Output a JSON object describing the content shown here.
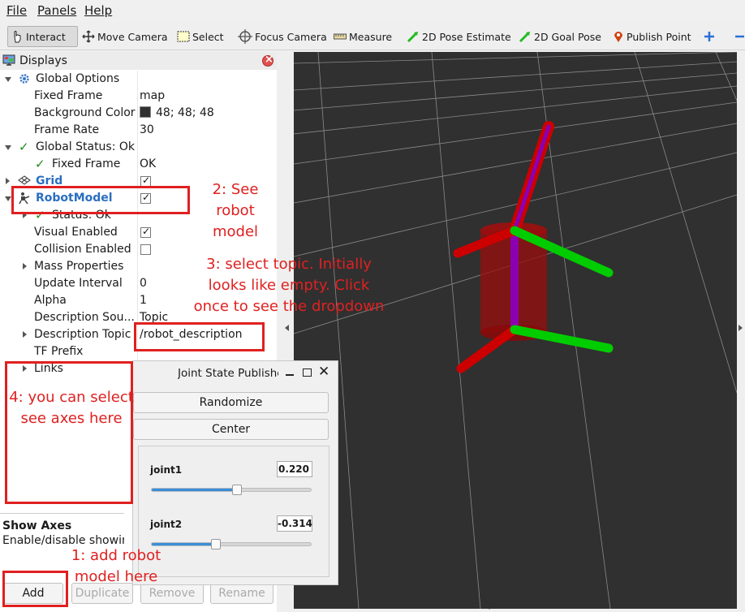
{
  "menu": [
    "File",
    "Panels",
    "Help"
  ],
  "toolbar": {
    "interact": "Interact",
    "move_camera": "Move Camera",
    "select": "Select",
    "focus_camera": "Focus Camera",
    "measure": "Measure",
    "pose_estimate": "2D Pose Estimate",
    "goal_pose": "2D Goal Pose",
    "publish_point": "Publish Point"
  },
  "displays": {
    "title": "Displays",
    "global_options": "Global Options",
    "fixed_frame_label": "Fixed Frame",
    "fixed_frame_value": "map",
    "background_color_label": "Background Color",
    "background_color_value": "48; 48; 48",
    "frame_rate_label": "Frame Rate",
    "frame_rate_value": "30",
    "global_status": "Global Status: Ok",
    "status_fixed_frame": "Fixed Frame",
    "status_fixed_frame_value": "OK",
    "grid": "Grid",
    "robot_model": "RobotModel",
    "status_ok": "Status: Ok",
    "visual_enabled": "Visual Enabled",
    "collision_enabled": "Collision Enabled",
    "mass_properties": "Mass Properties",
    "update_interval_label": "Update Interval",
    "update_interval_value": "0",
    "alpha_label": "Alpha",
    "alpha_value": "1",
    "description_source_label": "Description Sou...",
    "description_source_value": "Topic",
    "description_topic_label": "Description Topic",
    "description_topic_value": "/robot_description",
    "tf_prefix": "TF Prefix",
    "links": "Links"
  },
  "help": {
    "title": "Show Axes",
    "desc": "Enable/disable showing"
  },
  "buttons": {
    "add": "Add",
    "duplicate": "Duplicate",
    "remove": "Remove",
    "rename": "Rename"
  },
  "joint_state": {
    "title": "Joint State Publisher",
    "randomize": "Randomize",
    "center": "Center",
    "joint1_label": "joint1",
    "joint1_value": "0.220",
    "joint1_fraction": 0.53,
    "joint2_label": "joint2",
    "joint2_value": "-0.314",
    "joint2_fraction": 0.4
  },
  "annotations": {
    "a1_line1": "1: add robot",
    "a1_line2": "model here",
    "a2_line1": "2: See robot",
    "a2_line2": "model",
    "a3_line1": "3: select topic. Initially",
    "a3_line2": "looks like empty. Click",
    "a3_line3": "once to see the dropdown",
    "a4_line1": "4: you can select",
    "a4_line2": "see axes here"
  },
  "colors": {
    "viewport_bg": "#303030",
    "annotation_red": "#e02020",
    "robot_red": "#cc0000",
    "robot_purple": "#8b00b0",
    "axis_green": "#00cc00"
  }
}
